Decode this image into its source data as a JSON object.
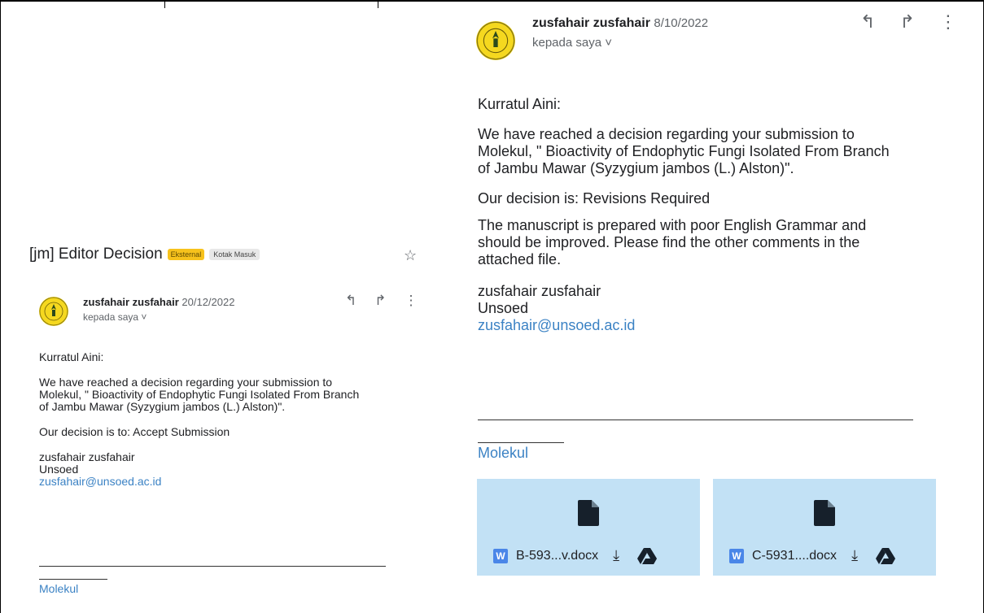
{
  "left_email": {
    "subject": "[jm] Editor Decision",
    "badge_external": "Eksternal",
    "badge_inbox": "Kotak Masuk",
    "sender_name": "zusfahair zusfahair",
    "date": "20/12/2022",
    "to": "kepada saya",
    "greeting": "Kurratul Aini:",
    "para1_line1": "We have reached a decision regarding your submission to",
    "para1_line2": "Molekul, \" Bioactivity of Endophytic Fungi Isolated From Branch",
    "para1_line3": "of Jambu Mawar (Syzygium jambos (L.) Alston)\".",
    "decision": "Our decision is to: Accept Submission",
    "sig_name": "zusfahair zusfahair",
    "sig_org": "Unsoed",
    "sig_email": "zusfahair@unsoed.ac.id",
    "footer_link": "Molekul"
  },
  "right_email": {
    "sender_name": "zusfahair zusfahair",
    "date": "8/10/2022",
    "to": "kepada saya",
    "greeting": "Kurratul Aini:",
    "para1_line1": "We have reached a decision regarding your submission to",
    "para1_line2": "Molekul, \" Bioactivity of Endophytic Fungi Isolated From Branch",
    "para1_line3": "of Jambu Mawar (Syzygium jambos (L.) Alston)\".",
    "decision": "Our decision is: Revisions Required",
    "para2_line1": "The manuscript is prepared with poor English Grammar and",
    "para2_line2": "should be improved. Please find the other comments in the",
    "para2_line3": "attached file.",
    "sig_name": "zusfahair zusfahair",
    "sig_org": "Unsoed",
    "sig_email": "zusfahair@unsoed.ac.id",
    "footer_link": "Molekul",
    "attachments": [
      {
        "name": "B-593...v.docx",
        "type_letter": "W"
      },
      {
        "name": "C-5931....docx",
        "type_letter": "W"
      }
    ]
  },
  "colors": {
    "avatar": "#f5d81f",
    "link": "#3b82c4",
    "attachment_bg": "#c2e1f5",
    "badge_external": "#f7c21c"
  },
  "icons": {
    "reply": "reply-icon",
    "forward": "forward-icon",
    "more": "more-vert-icon",
    "star": "star-icon",
    "download": "download-icon",
    "drive": "drive-icon",
    "document": "document-icon"
  }
}
